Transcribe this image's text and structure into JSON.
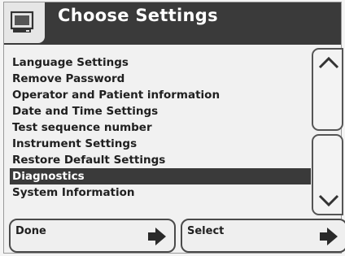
{
  "header": {
    "title": "Choose Settings",
    "icon": "monitor-icon"
  },
  "menu": {
    "items": [
      {
        "label": "Language Settings"
      },
      {
        "label": "Remove Password"
      },
      {
        "label": "Operator and Patient information"
      },
      {
        "label": "Date and Time Settings"
      },
      {
        "label": "Test sequence number"
      },
      {
        "label": "Instrument Settings"
      },
      {
        "label": "Restore Default Settings"
      },
      {
        "label": "Diagnostics"
      },
      {
        "label": "System Information"
      }
    ],
    "selected_label": "Diagnostics"
  },
  "scroll": {
    "up_icon": "chevron-up-icon",
    "down_icon": "chevron-down-icon"
  },
  "softkeys": {
    "left_label": "Done",
    "right_label": "Select",
    "arrow_icon": "arrow-right-icon"
  },
  "colors": {
    "header_bg": "#3a3a3a",
    "selected_bg": "#3a3a3a",
    "screen_bg": "#f1f1f1"
  }
}
